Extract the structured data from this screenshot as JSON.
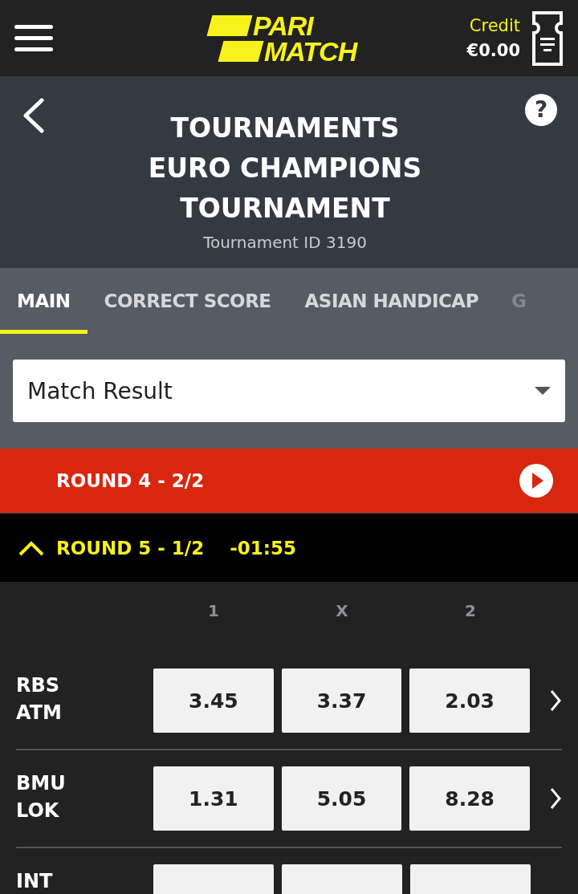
{
  "header": {
    "logo": [
      "PARI",
      "MATCH"
    ],
    "credit_label": "Credit",
    "credit_value": "€0.00"
  },
  "title_panel": {
    "lines": [
      "TOURNAMENTS",
      "EURO CHAMPIONS",
      "TOURNAMENT"
    ],
    "subtitle": "Tournament ID 3190",
    "help": "?"
  },
  "tabs": [
    {
      "label": "MAIN",
      "selected": true
    },
    {
      "label": "CORRECT SCORE",
      "selected": false
    },
    {
      "label": "ASIAN HANDICAP",
      "selected": false
    },
    {
      "label": "G",
      "selected": false
    }
  ],
  "market_select": {
    "value": "Match Result"
  },
  "rounds": [
    {
      "kind": "finished",
      "title": "ROUND 4 - 2/2"
    },
    {
      "kind": "open",
      "title": "ROUND 5 - 1/2",
      "time": "-01:55",
      "expanded": true
    }
  ],
  "columns": [
    "1",
    "X",
    "2"
  ],
  "matches": [
    {
      "teams": [
        "RBS",
        "ATM"
      ],
      "odds": [
        "3.45",
        "3.37",
        "2.03"
      ]
    },
    {
      "teams": [
        "BMU",
        "LOK"
      ],
      "odds": [
        "1.31",
        "5.05",
        "8.28"
      ]
    },
    {
      "teams": [
        "INT"
      ]
    }
  ]
}
